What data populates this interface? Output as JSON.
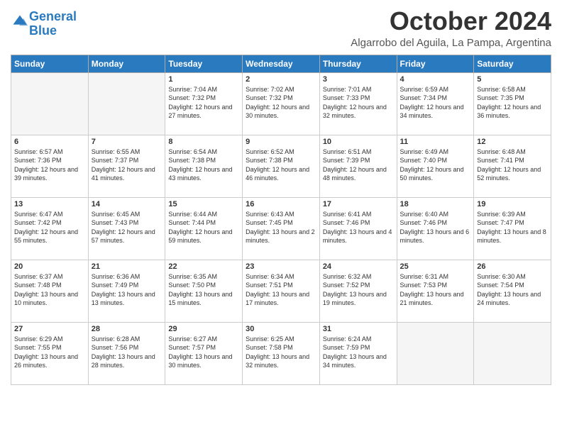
{
  "header": {
    "logo_general": "General",
    "logo_blue": "Blue",
    "month_title": "October 2024",
    "subtitle": "Algarrobo del Aguila, La Pampa, Argentina"
  },
  "days_of_week": [
    "Sunday",
    "Monday",
    "Tuesday",
    "Wednesday",
    "Thursday",
    "Friday",
    "Saturday"
  ],
  "weeks": [
    [
      {
        "day": "",
        "info": ""
      },
      {
        "day": "",
        "info": ""
      },
      {
        "day": "1",
        "info": "Sunrise: 7:04 AM\nSunset: 7:32 PM\nDaylight: 12 hours and 27 minutes."
      },
      {
        "day": "2",
        "info": "Sunrise: 7:02 AM\nSunset: 7:32 PM\nDaylight: 12 hours and 30 minutes."
      },
      {
        "day": "3",
        "info": "Sunrise: 7:01 AM\nSunset: 7:33 PM\nDaylight: 12 hours and 32 minutes."
      },
      {
        "day": "4",
        "info": "Sunrise: 6:59 AM\nSunset: 7:34 PM\nDaylight: 12 hours and 34 minutes."
      },
      {
        "day": "5",
        "info": "Sunrise: 6:58 AM\nSunset: 7:35 PM\nDaylight: 12 hours and 36 minutes."
      }
    ],
    [
      {
        "day": "6",
        "info": "Sunrise: 6:57 AM\nSunset: 7:36 PM\nDaylight: 12 hours and 39 minutes."
      },
      {
        "day": "7",
        "info": "Sunrise: 6:55 AM\nSunset: 7:37 PM\nDaylight: 12 hours and 41 minutes."
      },
      {
        "day": "8",
        "info": "Sunrise: 6:54 AM\nSunset: 7:38 PM\nDaylight: 12 hours and 43 minutes."
      },
      {
        "day": "9",
        "info": "Sunrise: 6:52 AM\nSunset: 7:38 PM\nDaylight: 12 hours and 46 minutes."
      },
      {
        "day": "10",
        "info": "Sunrise: 6:51 AM\nSunset: 7:39 PM\nDaylight: 12 hours and 48 minutes."
      },
      {
        "day": "11",
        "info": "Sunrise: 6:49 AM\nSunset: 7:40 PM\nDaylight: 12 hours and 50 minutes."
      },
      {
        "day": "12",
        "info": "Sunrise: 6:48 AM\nSunset: 7:41 PM\nDaylight: 12 hours and 52 minutes."
      }
    ],
    [
      {
        "day": "13",
        "info": "Sunrise: 6:47 AM\nSunset: 7:42 PM\nDaylight: 12 hours and 55 minutes."
      },
      {
        "day": "14",
        "info": "Sunrise: 6:45 AM\nSunset: 7:43 PM\nDaylight: 12 hours and 57 minutes."
      },
      {
        "day": "15",
        "info": "Sunrise: 6:44 AM\nSunset: 7:44 PM\nDaylight: 12 hours and 59 minutes."
      },
      {
        "day": "16",
        "info": "Sunrise: 6:43 AM\nSunset: 7:45 PM\nDaylight: 13 hours and 2 minutes."
      },
      {
        "day": "17",
        "info": "Sunrise: 6:41 AM\nSunset: 7:46 PM\nDaylight: 13 hours and 4 minutes."
      },
      {
        "day": "18",
        "info": "Sunrise: 6:40 AM\nSunset: 7:46 PM\nDaylight: 13 hours and 6 minutes."
      },
      {
        "day": "19",
        "info": "Sunrise: 6:39 AM\nSunset: 7:47 PM\nDaylight: 13 hours and 8 minutes."
      }
    ],
    [
      {
        "day": "20",
        "info": "Sunrise: 6:37 AM\nSunset: 7:48 PM\nDaylight: 13 hours and 10 minutes."
      },
      {
        "day": "21",
        "info": "Sunrise: 6:36 AM\nSunset: 7:49 PM\nDaylight: 13 hours and 13 minutes."
      },
      {
        "day": "22",
        "info": "Sunrise: 6:35 AM\nSunset: 7:50 PM\nDaylight: 13 hours and 15 minutes."
      },
      {
        "day": "23",
        "info": "Sunrise: 6:34 AM\nSunset: 7:51 PM\nDaylight: 13 hours and 17 minutes."
      },
      {
        "day": "24",
        "info": "Sunrise: 6:32 AM\nSunset: 7:52 PM\nDaylight: 13 hours and 19 minutes."
      },
      {
        "day": "25",
        "info": "Sunrise: 6:31 AM\nSunset: 7:53 PM\nDaylight: 13 hours and 21 minutes."
      },
      {
        "day": "26",
        "info": "Sunrise: 6:30 AM\nSunset: 7:54 PM\nDaylight: 13 hours and 24 minutes."
      }
    ],
    [
      {
        "day": "27",
        "info": "Sunrise: 6:29 AM\nSunset: 7:55 PM\nDaylight: 13 hours and 26 minutes."
      },
      {
        "day": "28",
        "info": "Sunrise: 6:28 AM\nSunset: 7:56 PM\nDaylight: 13 hours and 28 minutes."
      },
      {
        "day": "29",
        "info": "Sunrise: 6:27 AM\nSunset: 7:57 PM\nDaylight: 13 hours and 30 minutes."
      },
      {
        "day": "30",
        "info": "Sunrise: 6:25 AM\nSunset: 7:58 PM\nDaylight: 13 hours and 32 minutes."
      },
      {
        "day": "31",
        "info": "Sunrise: 6:24 AM\nSunset: 7:59 PM\nDaylight: 13 hours and 34 minutes."
      },
      {
        "day": "",
        "info": ""
      },
      {
        "day": "",
        "info": ""
      }
    ]
  ]
}
